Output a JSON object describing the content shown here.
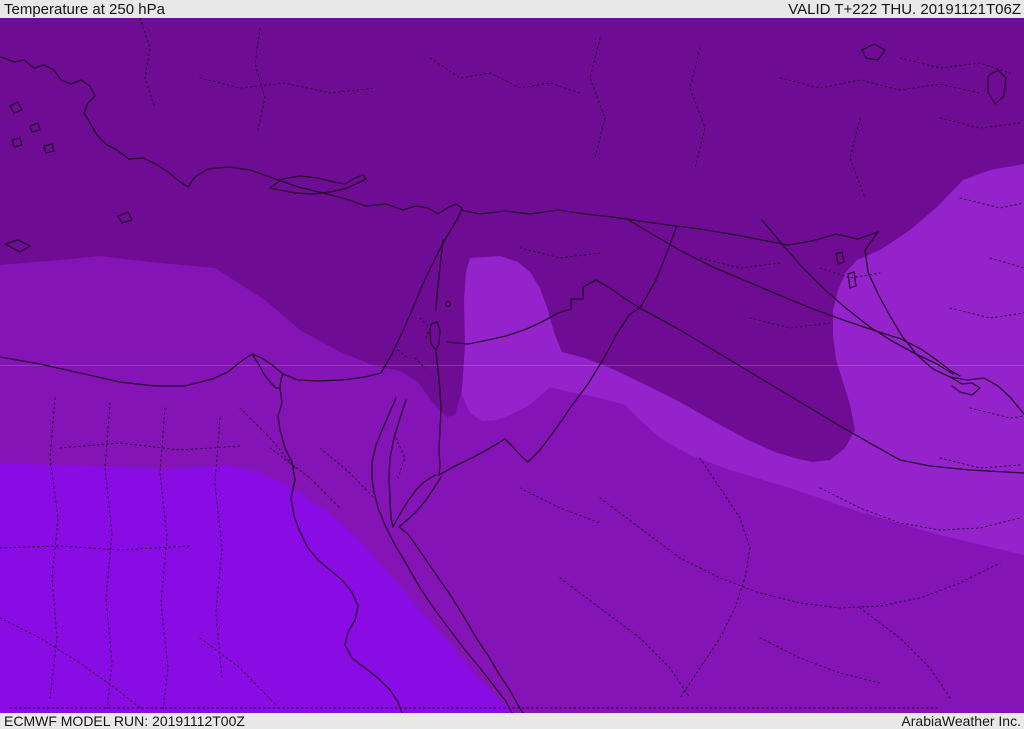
{
  "header": {
    "title": "Temperature at 250 hPa",
    "valid": "VALID T+222 THU. 20191121T06Z"
  },
  "footer": {
    "model_run": "ECMWF MODEL RUN: 20191112T00Z",
    "company": "ArabiaWeather Inc."
  },
  "map": {
    "region": "Middle East / Eastern Mediterranean",
    "colors": {
      "band_dark": "#6e0c94",
      "band_mid": "#8414b6",
      "band_light": "#9523cc",
      "band_violet": "#8a0ce4",
      "line": "#26062e",
      "bar_bg": "#e8e8e8",
      "bar_text": "#141414",
      "gridline": "rgba(255,255,255,0.17)"
    },
    "legend": {
      "band_dark": "coldest band (north: Turkey, Syria, N-Iraq, Levant tongue, N-Saudi lobe)",
      "band_mid": "middle band (NE Egypt, Sinai, Red Sea strip, S Jordan, S Saudi)",
      "band_light": "lighter band (E Jordan blob, Iraq-Iran east swath)",
      "band_violet": "bright violet band (SW Egypt / Libya corner)"
    }
  }
}
